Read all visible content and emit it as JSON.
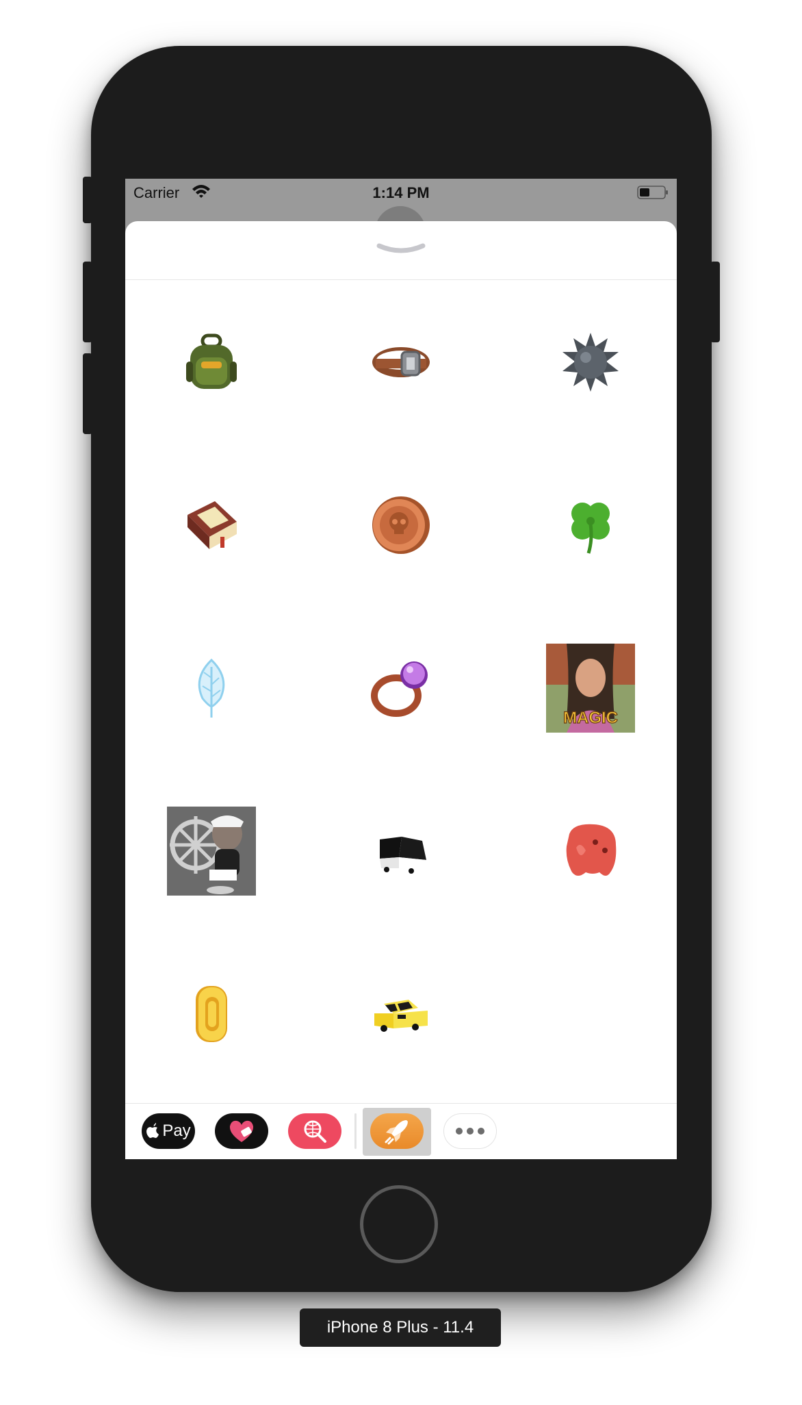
{
  "status_bar": {
    "carrier": "Carrier",
    "time": "1:14 PM",
    "icons": [
      "wifi-icon",
      "battery-icon"
    ]
  },
  "sheet": {
    "handle_icon": "chevron-down-icon"
  },
  "stickers": [
    {
      "name": "backpack-sticker"
    },
    {
      "name": "belt-sticker"
    },
    {
      "name": "spiked-ball-sticker"
    },
    {
      "name": "book-sticker"
    },
    {
      "name": "skull-coin-sticker"
    },
    {
      "name": "four-leaf-clover-sticker"
    },
    {
      "name": "feather-sticker"
    },
    {
      "name": "ring-sticker"
    },
    {
      "name": "magic-gif-sticker",
      "caption": "MAGIC"
    },
    {
      "name": "ship-wheel-gif-sticker"
    },
    {
      "name": "black-cube-car-sticker"
    },
    {
      "name": "red-blob-sticker"
    },
    {
      "name": "gold-coin-sticker"
    },
    {
      "name": "yellow-taxi-sticker"
    }
  ],
  "app_drawer": {
    "apps": [
      {
        "name": "apple-pay-app",
        "label": "Pay"
      },
      {
        "name": "heart-app"
      },
      {
        "name": "search-app"
      },
      {
        "name": "rocket-app",
        "selected": true
      },
      {
        "name": "more-apps"
      }
    ]
  },
  "device_label": "iPhone 8 Plus - 11.4",
  "colors": {
    "device_body": "#1c1c1c",
    "sheet_bg": "#ffffff",
    "status_bar_bg": "#9a9a9a",
    "search_app": "#ee4960",
    "rocket_app": "#f09a3a"
  }
}
